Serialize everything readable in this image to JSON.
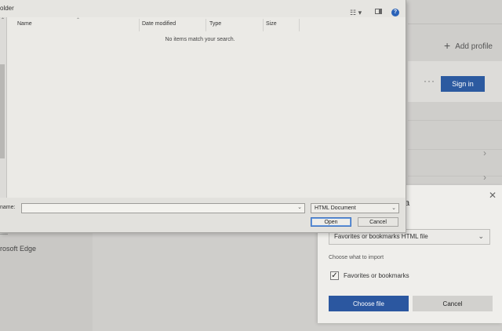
{
  "settings_page": {
    "add_profile_label": "Add profile",
    "sign_in_label": "Sign in",
    "more_label": "···",
    "sidebar_item": "rosoft Edge"
  },
  "import_dialog": {
    "title_fragment": "ta",
    "source_select_value": "Favorites or bookmarks HTML file",
    "choose_label": "Choose what to import",
    "checkbox_label": "Favorites or bookmarks",
    "checkbox_checked": true,
    "choose_file_label": "Choose file",
    "cancel_label": "Cancel",
    "accent_color": "#2b57a0"
  },
  "file_dialog": {
    "title_fragment": "older",
    "columns": [
      "Name",
      "Date modified",
      "Type",
      "Size"
    ],
    "empty_message": "No items match your search.",
    "file_name_label": "name:",
    "file_name_value": "",
    "file_type_value": "HTML Document",
    "open_label": "Open",
    "cancel_label": "Cancel",
    "icons": [
      "view-options-icon",
      "preview-pane-icon",
      "help-icon"
    ]
  }
}
